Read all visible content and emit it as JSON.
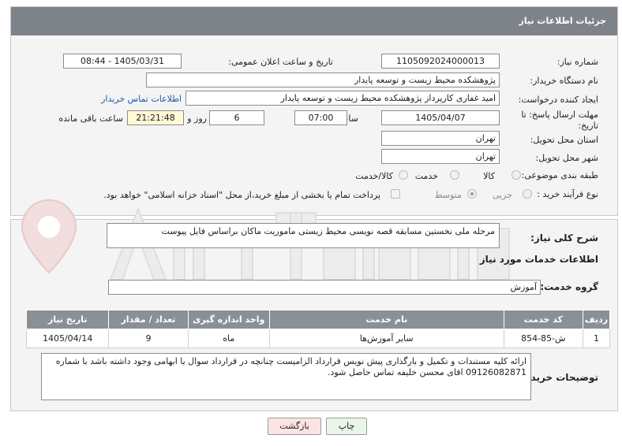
{
  "header": {
    "title": "جزئیات اطلاعات نیاز"
  },
  "need_number": {
    "label": "شماره نیاز:",
    "value": "1105092024000013"
  },
  "announce": {
    "label": "تاریخ و ساعت اعلان عمومی:",
    "value": "1405/03/31 - 08:44"
  },
  "buyer_org": {
    "label": "نام دستگاه خریدار:",
    "value": "پژوهشکده محیط زیست و توسعه پایدار"
  },
  "requester": {
    "label": "ایجاد کننده درخواست:",
    "value": "امید غفاری کارپرداز پژوهشکده محیط زیست و توسعه پایدار",
    "contact_link": "اطلاعات تماس خریدار"
  },
  "deadline": {
    "label": "مهلت ارسال پاسخ: تا تاریخ:",
    "date": "1405/04/07",
    "time_label": "ساعت",
    "time": "07:00",
    "days": "6",
    "days_label": "روز و",
    "remaining": "21:21:48",
    "remaining_label": "ساعت باقی مانده"
  },
  "province": {
    "label": "استان محل تحویل:",
    "value": "تهران"
  },
  "city": {
    "label": "شهر محل تحویل:",
    "value": "تهران"
  },
  "category": {
    "label": "طبقه بندی موضوعی:",
    "options": [
      "کالا",
      "خدمت",
      "کالا/خدمت"
    ]
  },
  "process": {
    "label": "نوع فرآیند خرید :",
    "options": [
      "جزیی",
      "متوسط"
    ],
    "note": "پرداخت تمام یا بخشی از مبلغ خرید،از محل \"اسناد خزانه اسلامی\" خواهد بود."
  },
  "summary": {
    "label": "شرح کلی نیاز:",
    "value": "مرحله ملی نخستین مسابقه قصه نویسی محیط زیستی ماموریت ماکان براساس فایل پیوست"
  },
  "services_title": "اطلاعات خدمات مورد نیاز",
  "service_group": {
    "label": "گروه خدمت:",
    "value": "آموزش"
  },
  "table": {
    "headers": [
      "ردیف",
      "کد خدمت",
      "نام خدمت",
      "واحد اندازه گیری",
      "تعداد / مقدار",
      "تاریخ نیاز"
    ],
    "rows": [
      [
        "1",
        "ش-85-854",
        "سایر آموزش‌ها",
        "ماه",
        "9",
        "1405/04/14"
      ]
    ]
  },
  "buyer_notes": {
    "label": "توضیحات خریدار:",
    "value": "ارائه کلیه مستندات و تکمیل و بارگذاری پیش نویس قرارداد الزامیست چنانچه در قرارداد سوال یا ابهامی وجود داشته باشد با شماره 09126082871 اقای محسن خلیفه تماس حاصل شود."
  },
  "buttons": {
    "print": "چاپ",
    "back": "بازگشت"
  },
  "colors": {
    "header": "#7d8389",
    "table_header": "#8a9096",
    "link": "#1d5aa8"
  }
}
